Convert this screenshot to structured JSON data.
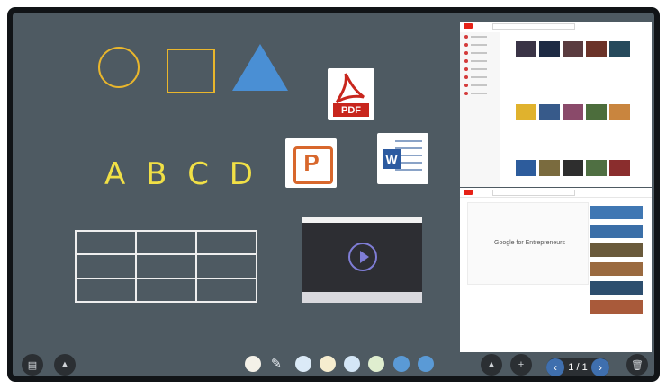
{
  "whiteboard": {
    "letters": "A B C D",
    "pdf_label": "PDF",
    "ppt_letter": "P",
    "word_letter": "W"
  },
  "browser_bottom": {
    "video_title": "Google for Entrepreneurs"
  },
  "pager": {
    "page_indicator": "1 / 1"
  },
  "colors": {
    "board": "#4e5a62",
    "shape_outline": "#e9b62c",
    "triangle": "#4a8fd4",
    "letters": "#f1e046",
    "pdf_red": "#c8261d",
    "ppt_orange": "#d8672c",
    "word_blue": "#2c5aa0",
    "youtube_red": "#e62117"
  },
  "icons": {
    "menu": "grid-icon",
    "undo_redo": "triangle-icon",
    "hand": "hand-icon",
    "pen": "pen-icon",
    "brush": "brush-icon",
    "note": "note-icon",
    "export": "export-icon",
    "recycle": "recycle-icon",
    "back": "undo-icon",
    "forward": "redo-icon",
    "add": "plus-icon",
    "delete": "trash-icon"
  }
}
